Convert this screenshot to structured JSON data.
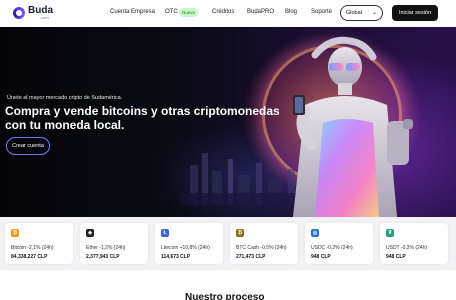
{
  "brand": {
    "name": "Buda",
    "sub": ".com"
  },
  "nav": {
    "items": [
      "Cuenta Empresa",
      "OTC",
      "Créditos",
      "BudaPRO",
      "Blog",
      "Soporte"
    ],
    "otc_badge": "Nuevo",
    "region_select": "Global",
    "login_label": "Iniciar sesión"
  },
  "hero": {
    "tagline": "Únete al mayor mercado cripto de Sudamérica.",
    "headline": "Compra y vende bitcoins y otras criptomonedas con tu moneda local.",
    "cta_label": "Crear cuenta"
  },
  "tickers": [
    {
      "icon": "bitcoin-icon",
      "symbol": "₿",
      "color": "#f7931a",
      "label": "Bitcoin -2,1% (24h)",
      "price": "84,338,227 CLP"
    },
    {
      "icon": "ether-icon",
      "symbol": "◆",
      "color": "#1f1f2e",
      "label": "Ether -1,2% (24h)",
      "price": "2,377,943 CLP"
    },
    {
      "icon": "litecoin-icon",
      "symbol": "Ł",
      "color": "#3c66d8",
      "label": "Litecoin +10,8% (24h)",
      "price": "114,673 CLP"
    },
    {
      "icon": "bitcoin-cash-icon",
      "symbol": "₿",
      "color": "#8a6d1a",
      "label": "BTC Cash -0,5% (24h)",
      "price": "271,473 CLP"
    },
    {
      "icon": "usdc-icon",
      "symbol": "◎",
      "color": "#2775ca",
      "label": "USDC -0,2% (24h)",
      "price": "948 CLP"
    },
    {
      "icon": "usdt-icon",
      "symbol": "₮",
      "color": "#26a17b",
      "label": "USDT -0,2% (24h)",
      "price": "948 CLP"
    }
  ],
  "section_heading_partial": "Nuestro proceso",
  "colors": {
    "accent": "#5b3df5",
    "cta_border": "#6b7cff",
    "login_bg": "#111111"
  }
}
